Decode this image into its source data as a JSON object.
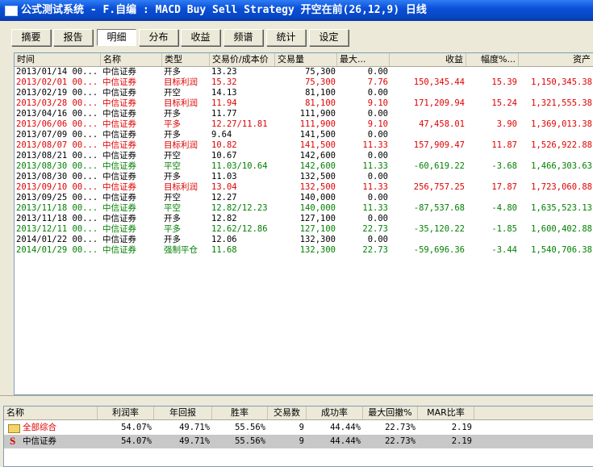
{
  "window": {
    "title": "公式测试系统 - F.自编 : MACD Buy Sell Strategy 开空在前(26,12,9) 日线"
  },
  "tabs": [
    "摘要",
    "报告",
    "明细",
    "分布",
    "收益",
    "频谱",
    "统计",
    "设定"
  ],
  "active_tab": 2,
  "colors": {
    "red": "#e00000",
    "green": "#008000",
    "black": "#000000"
  },
  "columns": [
    "时间",
    "名称",
    "类型",
    "交易价/成本价",
    "交易量",
    "最大...",
    "收益",
    "幅度%...",
    "资产"
  ],
  "rows": [
    {
      "c": "black",
      "cells": [
        "2013/01/14 00...",
        "中信证券",
        "开多",
        "13.23",
        "75,300",
        "0.00",
        "",
        "",
        ""
      ]
    },
    {
      "c": "red",
      "cells": [
        "2013/02/01 00...",
        "中信证券",
        "目标利润",
        "15.32",
        "75,300",
        "7.76",
        "150,345.44",
        "15.39",
        "1,150,345.38"
      ]
    },
    {
      "c": "black",
      "cells": [
        "2013/02/19 00...",
        "中信证券",
        "开空",
        "14.13",
        "81,100",
        "0.00",
        "",
        "",
        ""
      ]
    },
    {
      "c": "red",
      "cells": [
        "2013/03/28 00...",
        "中信证券",
        "目标利润",
        "11.94",
        "81,100",
        "9.10",
        "171,209.94",
        "15.24",
        "1,321,555.38"
      ]
    },
    {
      "c": "black",
      "cells": [
        "2013/04/16 00...",
        "中信证券",
        "开多",
        "11.77",
        "111,900",
        "0.00",
        "",
        "",
        ""
      ]
    },
    {
      "c": "red",
      "cells": [
        "2013/06/06 00...",
        "中信证券",
        "平多",
        "12.27/11.81",
        "111,900",
        "9.10",
        "47,458.01",
        "3.90",
        "1,369,013.38"
      ]
    },
    {
      "c": "black",
      "cells": [
        "2013/07/09 00...",
        "中信证券",
        "开多",
        "9.64",
        "141,500",
        "0.00",
        "",
        "",
        ""
      ]
    },
    {
      "c": "red",
      "cells": [
        "2013/08/07 00...",
        "中信证券",
        "目标利润",
        "10.82",
        "141,500",
        "11.33",
        "157,909.47",
        "11.87",
        "1,526,922.88"
      ]
    },
    {
      "c": "black",
      "cells": [
        "2013/08/21 00...",
        "中信证券",
        "开空",
        "10.67",
        "142,600",
        "0.00",
        "",
        "",
        ""
      ]
    },
    {
      "c": "green",
      "cells": [
        "2013/08/30 00...",
        "中信证券",
        "平空",
        "11.03/10.64",
        "142,600",
        "11.33",
        "-60,619.22",
        "-3.68",
        "1,466,303.63"
      ]
    },
    {
      "c": "black",
      "cells": [
        "2013/08/30 00...",
        "中信证券",
        "开多",
        "11.03",
        "132,500",
        "0.00",
        "",
        "",
        ""
      ]
    },
    {
      "c": "red",
      "cells": [
        "2013/09/10 00...",
        "中信证券",
        "目标利润",
        "13.04",
        "132,500",
        "11.33",
        "256,757.25",
        "17.87",
        "1,723,060.88"
      ]
    },
    {
      "c": "black",
      "cells": [
        "2013/09/25 00...",
        "中信证券",
        "开空",
        "12.27",
        "140,000",
        "0.00",
        "",
        "",
        ""
      ]
    },
    {
      "c": "green",
      "cells": [
        "2013/11/18 00...",
        "中信证券",
        "平空",
        "12.82/12.23",
        "140,000",
        "11.33",
        "-87,537.68",
        "-4.80",
        "1,635,523.13"
      ]
    },
    {
      "c": "black",
      "cells": [
        "2013/11/18 00...",
        "中信证券",
        "开多",
        "12.82",
        "127,100",
        "0.00",
        "",
        "",
        ""
      ]
    },
    {
      "c": "green",
      "cells": [
        "2013/12/11 00...",
        "中信证券",
        "平多",
        "12.62/12.86",
        "127,100",
        "22.73",
        "-35,120.22",
        "-1.85",
        "1,600,402.88"
      ]
    },
    {
      "c": "black",
      "cells": [
        "2014/01/22 00...",
        "中信证券",
        "开多",
        "12.06",
        "132,300",
        "0.00",
        "",
        "",
        ""
      ]
    },
    {
      "c": "green",
      "cells": [
        "2014/01/29 00...",
        "中信证券",
        "强制平仓",
        "11.68",
        "132,300",
        "22.73",
        "-59,696.36",
        "-3.44",
        "1,540,706.38"
      ]
    }
  ],
  "summary": {
    "columns": [
      "名称",
      "利润率",
      "年回报",
      "胜率",
      "交易数",
      "成功率",
      "最大回撤%",
      "MAR比率"
    ],
    "rows": [
      {
        "icon": "folder-icon",
        "c": "red",
        "cells": [
          "全部综合",
          "54.07%",
          "49.71%",
          "55.56%",
          "9",
          "44.44%",
          "22.73%",
          "2.19"
        ]
      },
      {
        "icon": "s-icon",
        "icon_text": "S",
        "c": "black",
        "cells": [
          "中信证券",
          "54.07%",
          "49.71%",
          "55.56%",
          "9",
          "44.44%",
          "22.73%",
          "2.19"
        ]
      }
    ]
  }
}
